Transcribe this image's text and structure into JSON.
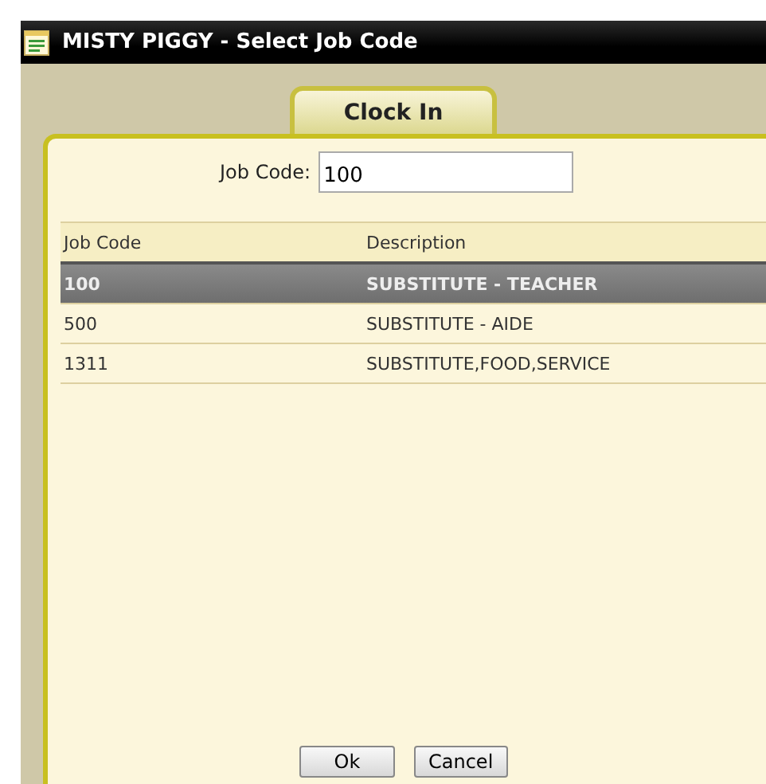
{
  "window": {
    "title": "MISTY PIGGY - Select Job Code"
  },
  "tabs": [
    {
      "label": "Clock In",
      "selected": true
    }
  ],
  "job_code_field": {
    "label": "Job Code:",
    "value": "100"
  },
  "table": {
    "columns": [
      "Job Code",
      "Description"
    ],
    "rows": [
      {
        "cells": [
          "100",
          "SUBSTITUTE - TEACHER"
        ],
        "selected": true
      },
      {
        "cells": [
          "500",
          "SUBSTITUTE - AIDE"
        ],
        "selected": false
      },
      {
        "cells": [
          "1311",
          "SUBSTITUTE,FOOD,SERVICE"
        ],
        "selected": false
      }
    ]
  },
  "buttons": [
    "Ok",
    "Cancel"
  ]
}
